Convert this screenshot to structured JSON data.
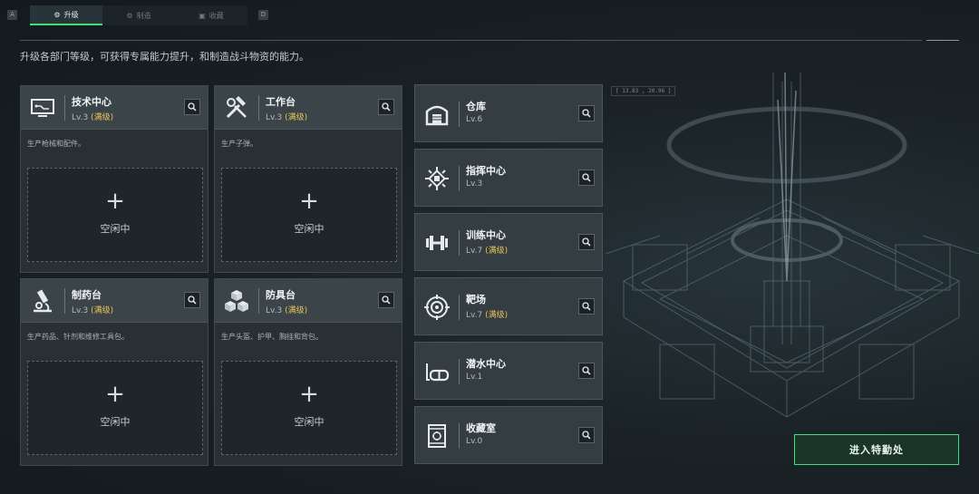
{
  "keys": {
    "left": "A",
    "right": "D"
  },
  "tabs": [
    {
      "label": "升级",
      "icon": "upgrade-icon"
    },
    {
      "label": "制造",
      "icon": "gear-icon"
    },
    {
      "label": "收藏",
      "icon": "collection-icon"
    }
  ],
  "subtitle": "升级各部门等级，可获得专属能力提升，和制造战斗物资的能力。",
  "cards": [
    {
      "name": "技术中心",
      "level": "Lv.3",
      "max": "(满级)",
      "desc": "生产枪械和配件。",
      "plus": "+",
      "status": "空闲中",
      "icon": "computer-icon"
    },
    {
      "name": "工作台",
      "level": "Lv.3",
      "max": "(满级)",
      "desc": "生产子弹。",
      "plus": "+",
      "status": "空闲中",
      "icon": "tools-icon"
    },
    {
      "name": "制药台",
      "level": "Lv.3",
      "max": "(满级)",
      "desc": "生产药品、针剂和维修工具包。",
      "plus": "+",
      "status": "空闲中",
      "icon": "microscope-icon"
    },
    {
      "name": "防具台",
      "level": "Lv.3",
      "max": "(满级)",
      "desc": "生产头盔、护甲、胸挂和背包。",
      "plus": "+",
      "status": "空闲中",
      "icon": "cubes-icon"
    }
  ],
  "rows": [
    {
      "name": "仓库",
      "level": "Lv.6",
      "max": "",
      "icon": "warehouse-icon"
    },
    {
      "name": "指挥中心",
      "level": "Lv.3",
      "max": "",
      "icon": "chip-icon"
    },
    {
      "name": "训练中心",
      "level": "Lv.7",
      "max": "(满级)",
      "icon": "dumbbell-icon"
    },
    {
      "name": "靶场",
      "level": "Lv.7",
      "max": "(满级)",
      "icon": "target-icon"
    },
    {
      "name": "潜水中心",
      "level": "Lv.1",
      "max": "",
      "icon": "diving-mask-icon"
    },
    {
      "name": "收藏室",
      "level": "Lv.0",
      "max": "",
      "icon": "vault-icon"
    }
  ],
  "coords": "[ 13.83 , 20.96 ]",
  "enter_button": "进入特勤处",
  "colors": {
    "accent": "#3ee07a",
    "maxed": "#e7c35a"
  }
}
